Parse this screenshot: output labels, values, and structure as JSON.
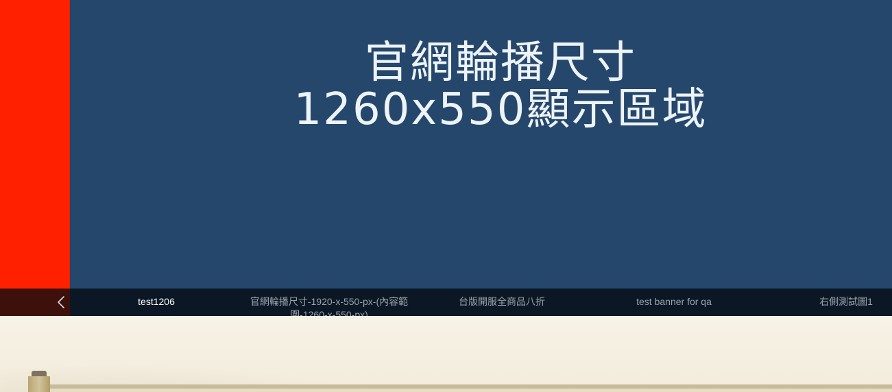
{
  "hero": {
    "title_line1": "官網輪播尺寸",
    "title_line2": "1260x550顯示區域",
    "bg_color": "#24476b",
    "strip_color": "#ff2000"
  },
  "carousel_nav": {
    "prev_icon": "chevron-left-icon",
    "tabs": [
      {
        "label": "test1206",
        "active": true
      },
      {
        "label": "官網輪播尺寸-1920-x-550-px-(內容範圍-1260-x-550-px)",
        "active": false
      },
      {
        "label": "台版開服全商品八折",
        "active": false
      },
      {
        "label": "test banner for qa",
        "active": false
      },
      {
        "label": "右側測試圖1",
        "active": false
      }
    ]
  },
  "decoration": {
    "scroll_icon": "scroll-rod-icon"
  }
}
